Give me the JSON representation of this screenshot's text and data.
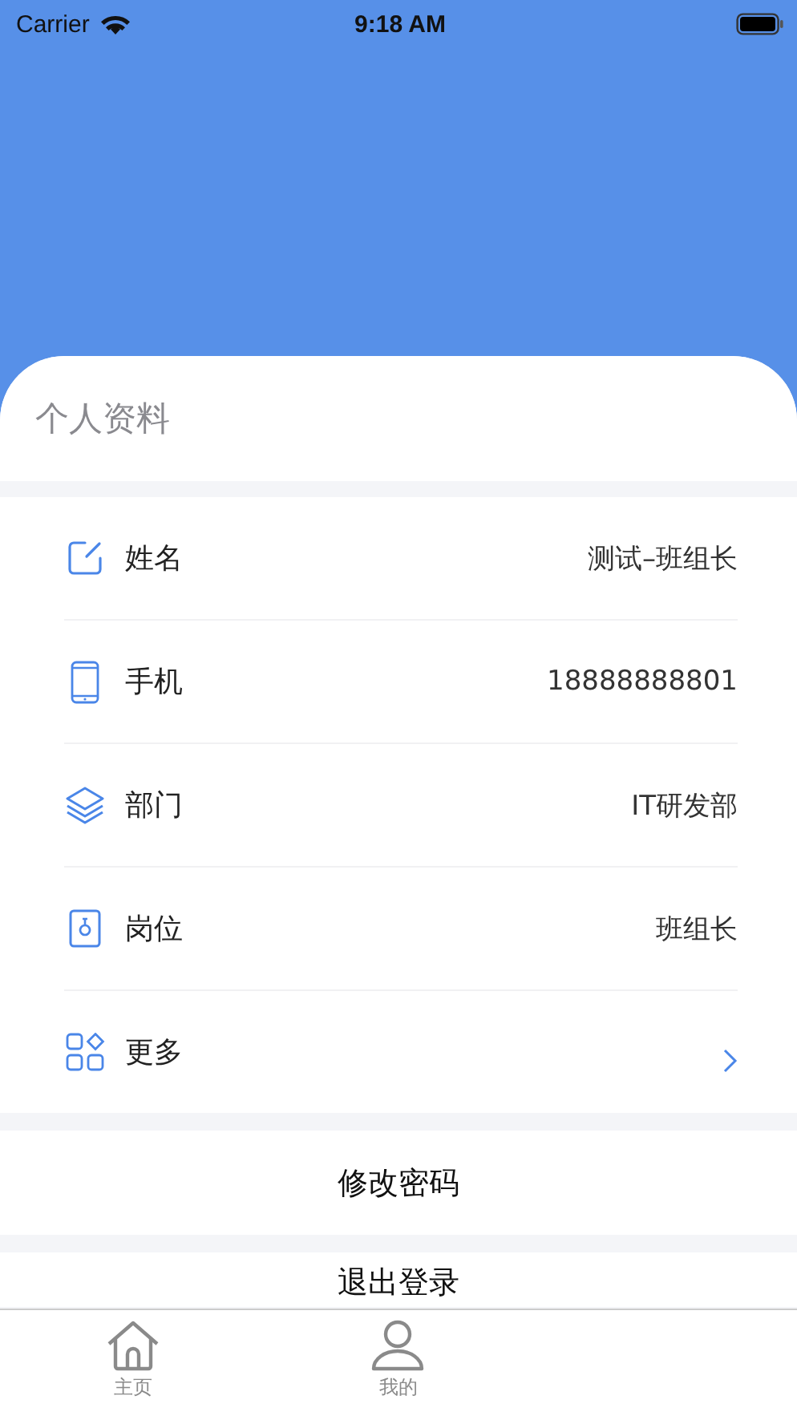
{
  "status_bar": {
    "carrier": "Carrier",
    "time": "9:18 AM"
  },
  "profile": {
    "title": "个人资料",
    "rows": [
      {
        "kind": "edit",
        "label": "姓名",
        "value": "测试–班组长",
        "chevron": false
      },
      {
        "kind": "phone",
        "label": "手机",
        "value": "18888888801",
        "chevron": false
      },
      {
        "kind": "layers",
        "label": "部门",
        "value": "IT研发部",
        "chevron": false
      },
      {
        "kind": "badge",
        "label": "岗位",
        "value": "班组长",
        "chevron": false
      },
      {
        "kind": "grid",
        "label": "更多",
        "chevron": true
      }
    ]
  },
  "actions": [
    "修改密码",
    "退出登录"
  ],
  "tab_bar": [
    {
      "kind": "home",
      "label": "主页",
      "selected": false
    },
    {
      "kind": "user",
      "label": "我的",
      "selected": false
    }
  ]
}
